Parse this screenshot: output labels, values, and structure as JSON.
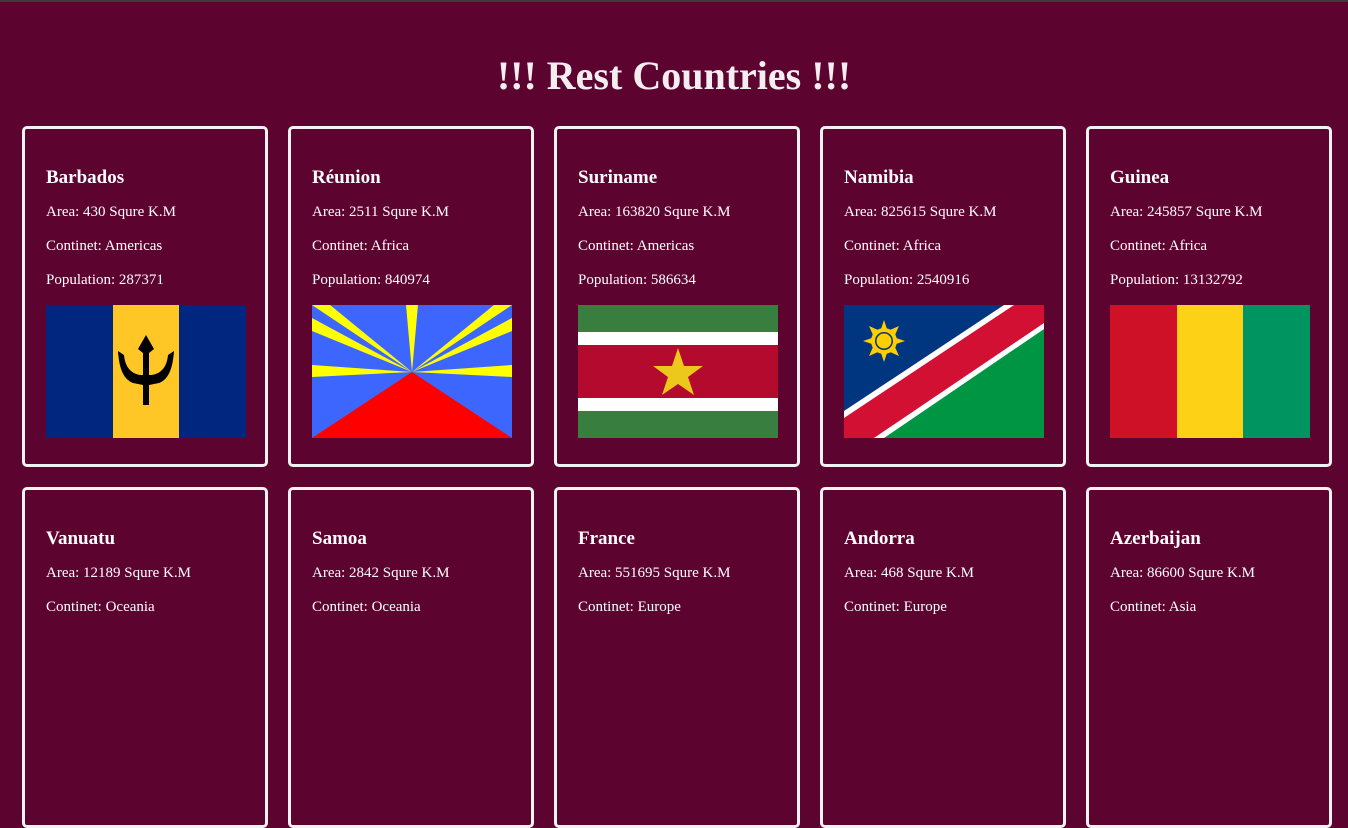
{
  "title": "!!! Rest Countries !!!",
  "labels": {
    "area": "Area: ",
    "area_unit": " Squre K.M",
    "continent": "Continet: ",
    "population": "Population: "
  },
  "countries": [
    {
      "name": "Barbados",
      "area": "430",
      "continent": "Americas",
      "population": "287371",
      "flag": "barbados"
    },
    {
      "name": "Réunion",
      "area": "2511",
      "continent": "Africa",
      "population": "840974",
      "flag": "reunion"
    },
    {
      "name": "Suriname",
      "area": "163820",
      "continent": "Americas",
      "population": "586634",
      "flag": "suriname"
    },
    {
      "name": "Namibia",
      "area": "825615",
      "continent": "Africa",
      "population": "2540916",
      "flag": "namibia"
    },
    {
      "name": "Guinea",
      "area": "245857",
      "continent": "Africa",
      "population": "13132792",
      "flag": "guinea"
    },
    {
      "name": "Vanuatu",
      "area": "12189",
      "continent": "Oceania"
    },
    {
      "name": "Samoa",
      "area": "2842",
      "continent": "Oceania"
    },
    {
      "name": "France",
      "area": "551695",
      "continent": "Europe"
    },
    {
      "name": "Andorra",
      "area": "468",
      "continent": "Europe"
    },
    {
      "name": "Azerbaijan",
      "area": "86600",
      "continent": "Asia"
    }
  ],
  "colors": {
    "background": "#5d0330",
    "card_border": "#f2f2f2",
    "text": "#ffffff"
  }
}
